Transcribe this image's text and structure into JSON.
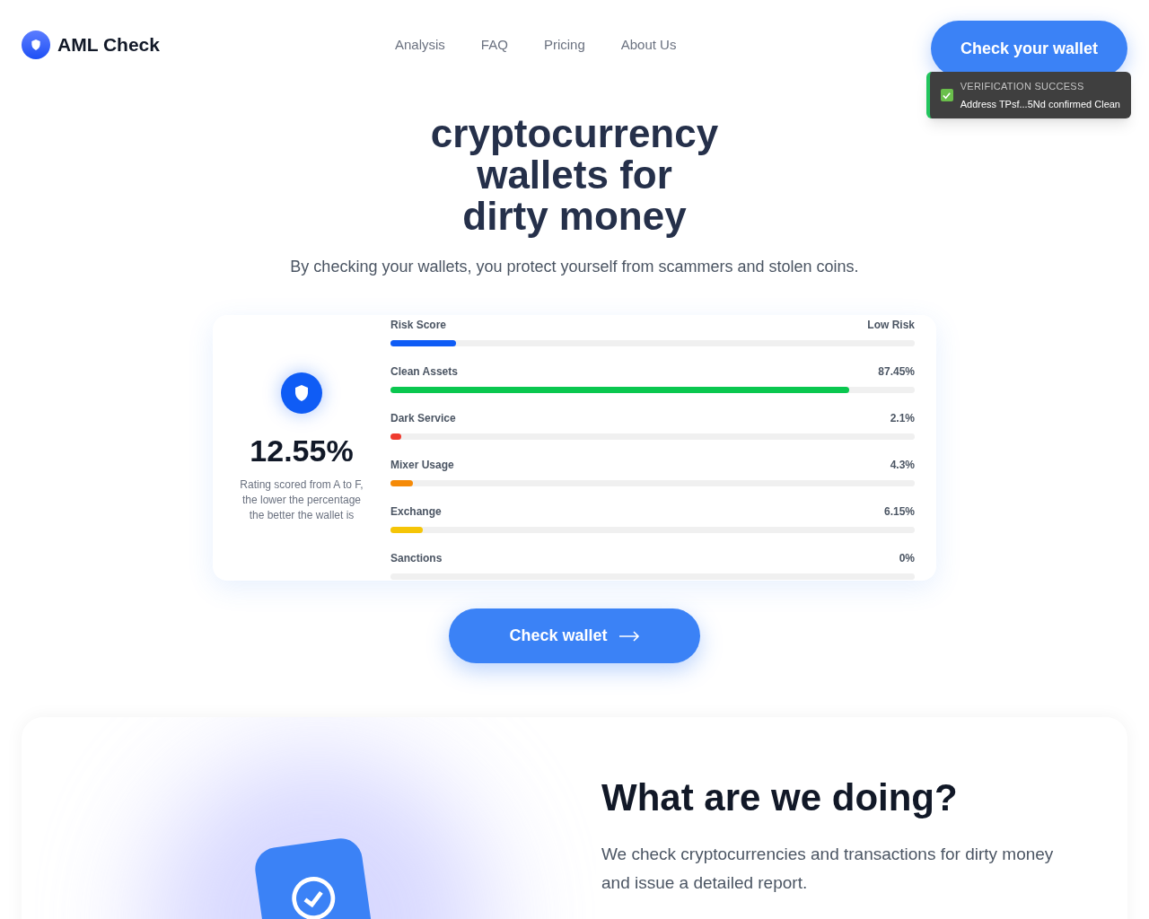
{
  "header": {
    "logo": "AML Check",
    "nav": [
      {
        "label": "Analysis"
      },
      {
        "label": "FAQ"
      },
      {
        "label": "Pricing"
      },
      {
        "label": "About Us"
      }
    ],
    "cta": "Check your wallet"
  },
  "toast": {
    "title": "VERIFICATION SUCCESS",
    "message": "Address TPsf...5Nd confirmed Clean",
    "checked": true
  },
  "hero": {
    "title_lines": [
      "cryptocurrency",
      "wallets for",
      "dirty money"
    ],
    "subtitle": "By checking your wallets, you protect yourself from scammers and stolen coins."
  },
  "report": {
    "score": "12.55%",
    "note": "Rating scored from A to F, the lower the percentage the better the wallet is",
    "metrics": [
      {
        "label": "Risk Score",
        "reading": "Low Risk",
        "level": 0.125,
        "color": "#0f5cf5"
      },
      {
        "label": "Clean Assets",
        "reading": "87.45%",
        "level": 0.8745,
        "color": "#0ac74f"
      },
      {
        "label": "Dark Service",
        "reading": "2.1%",
        "level": 0.021,
        "color": "#ef3b2f"
      },
      {
        "label": "Mixer Usage",
        "reading": "4.3%",
        "level": 0.043,
        "color": "#f58a07"
      },
      {
        "label": "Exchange",
        "reading": "6.15%",
        "level": 0.0615,
        "color": "#f5c507"
      },
      {
        "label": "Sanctions",
        "reading": "0%"
      }
    ]
  },
  "check_button": "Check wallet",
  "about": {
    "title": "What are we doing?",
    "text": "We check cryptocurrencies and transactions for dirty money and issue a detailed report."
  }
}
